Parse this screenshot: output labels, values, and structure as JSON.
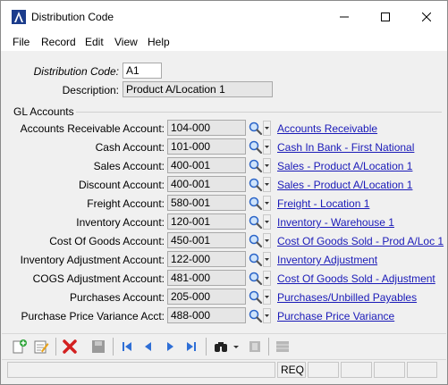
{
  "window": {
    "title": "Distribution Code",
    "controls": {
      "minimize": "minimize",
      "maximize": "maximize",
      "close": "close"
    }
  },
  "menu": [
    "File",
    "Record",
    "Edit",
    "View",
    "Help"
  ],
  "header": {
    "code_label": "Distribution Code:",
    "code_value": "A1",
    "description_label": "Description:",
    "description_value": "Product A/Location 1"
  },
  "gl_accounts": {
    "title": "GL Accounts",
    "rows": [
      {
        "label": "Accounts Receivable Account:",
        "value": "104-000",
        "link": "Accounts Receivable"
      },
      {
        "label": "Cash Account:",
        "value": "101-000",
        "link": "Cash In Bank - First National"
      },
      {
        "label": "Sales Account:",
        "value": "400-001",
        "link": "Sales - Product A/Location 1"
      },
      {
        "label": "Discount Account:",
        "value": "400-001",
        "link": "Sales - Product A/Location 1"
      },
      {
        "label": "Freight Account:",
        "value": "580-001",
        "link": "Freight - Location 1"
      },
      {
        "label": "Inventory Account:",
        "value": "120-001",
        "link": "Inventory - Warehouse 1"
      },
      {
        "label": "Cost Of Goods Account:",
        "value": "450-001",
        "link": "Cost Of Goods Sold - Prod A/Loc 1"
      },
      {
        "label": "Inventory Adjustment Account:",
        "value": "122-000",
        "link": "Inventory Adjustment"
      },
      {
        "label": "COGS Adjustment Account:",
        "value": "481-000",
        "link": "Cost Of Goods Sold - Adjustment"
      },
      {
        "label": "Purchases Account:",
        "value": "205-000",
        "link": "Purchases/Unbilled Payables"
      },
      {
        "label": "Purchase Price Variance Acct:",
        "value": "488-000",
        "link": "Purchase Price Variance"
      }
    ]
  },
  "toolbar": {
    "icons": [
      "new-record-icon",
      "edit-record-icon",
      "delete-icon",
      "save-icon",
      "first-record-icon",
      "previous-record-icon",
      "next-record-icon",
      "last-record-icon",
      "find-icon",
      "find-dropdown-icon",
      "print-icon",
      "list-icon"
    ]
  },
  "status": {
    "req": "REQ"
  },
  "colors": {
    "link": "#1a1ab8",
    "field_bg": "#e6e6e6",
    "delete": "#d32020",
    "nav": "#2f6fd6"
  }
}
